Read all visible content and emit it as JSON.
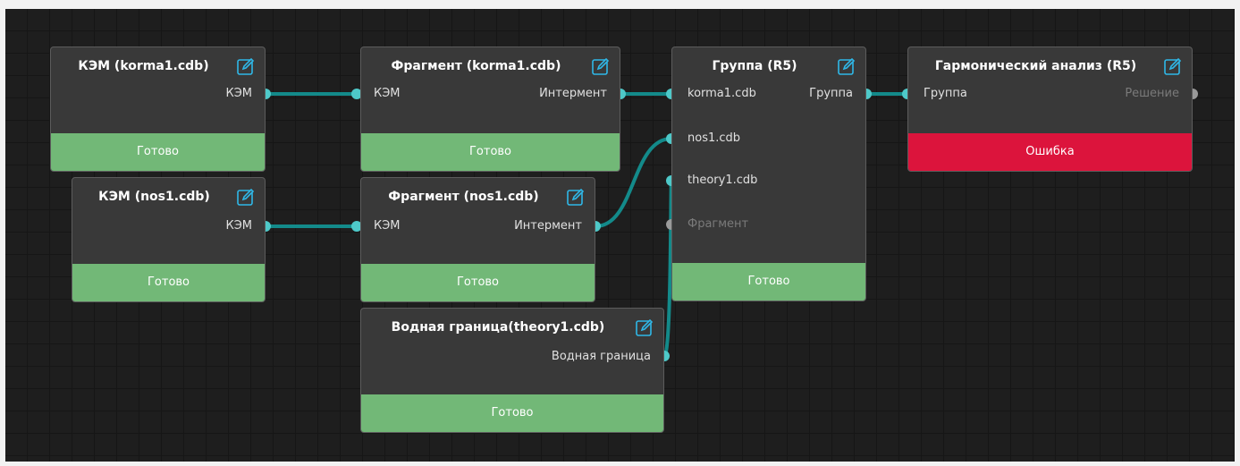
{
  "colors": {
    "canvas": "#1e1e1e",
    "node_body": "#393939",
    "status_ok": "#72b877",
    "status_error": "#dc143c",
    "link": "#138a8a",
    "port_active": "#4ec9c9",
    "port_inactive": "#9a9a9a",
    "edit_icon": "#2fb8e8"
  },
  "nodes": {
    "kem_korma": {
      "title": "КЭМ (korma1.cdb)",
      "out_port": "КЭМ",
      "status": "Готово"
    },
    "kem_nos": {
      "title": "КЭМ (nos1.cdb)",
      "out_port": "КЭМ",
      "status": "Готово"
    },
    "frag_korma": {
      "title": "Фрагмент (korma1.cdb)",
      "in_port": "КЭМ",
      "out_port": "Интермент",
      "status": "Готово"
    },
    "frag_nos": {
      "title": "Фрагмент (nos1.cdb)",
      "in_port": "КЭМ",
      "out_port": "Интермент",
      "status": "Готово"
    },
    "water": {
      "title": "Водная граница(theory1.cdb)",
      "out_port": "Водная граница",
      "status": "Готово"
    },
    "group": {
      "title": "Группа (R5)",
      "in_ports": [
        "korma1.cdb",
        "nos1.cdb",
        "theory1.cdb",
        "Фрагмент"
      ],
      "out_port": "Группа",
      "status": "Готово"
    },
    "harmonic": {
      "title": "Гармонический анализ (R5)",
      "in_port": "Группа",
      "out_port": "Решение",
      "status": "Ошибка"
    }
  }
}
